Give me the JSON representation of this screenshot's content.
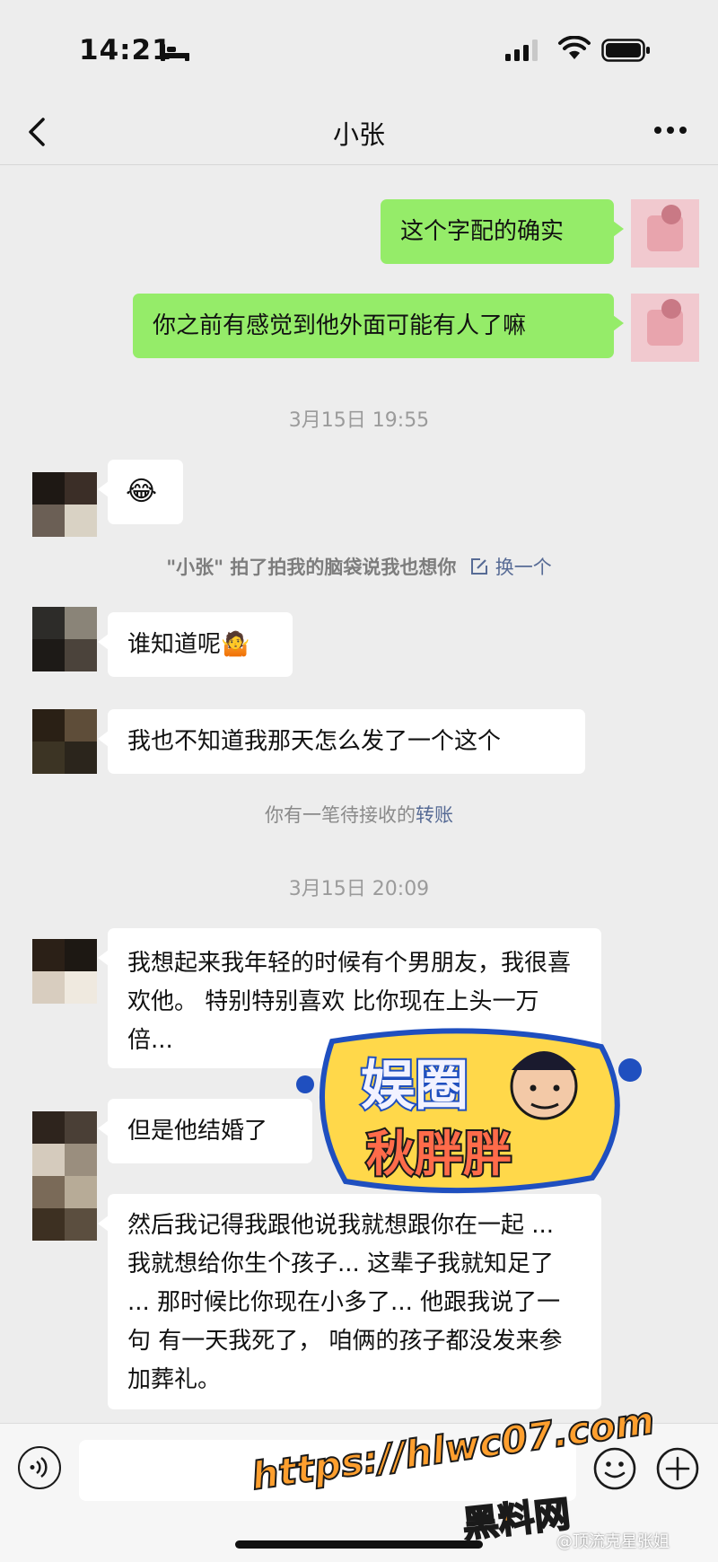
{
  "status_bar": {
    "time": "14:21",
    "icons": [
      "bed-icon",
      "signal-icon",
      "wifi-icon",
      "battery-icon"
    ]
  },
  "nav": {
    "back_icon": "chevron-left-icon",
    "title": "小张",
    "more_icon": "more-icon"
  },
  "messages": [
    {
      "side": "right",
      "text": "这个字配的确实"
    },
    {
      "side": "right",
      "text": "你之前有感觉到他外面可能有人了嘛"
    },
    {
      "type": "timestamp",
      "text": "3月15日 19:55"
    },
    {
      "side": "left",
      "text": "😂"
    },
    {
      "type": "pat",
      "text": "\"小张\" 拍了拍我的脑袋说我也想你",
      "link": "换一个",
      "link_icon": "edit-icon"
    },
    {
      "side": "left",
      "text": "谁知道呢🤷"
    },
    {
      "side": "left",
      "text": "我也不知道我那天怎么发了一个这个"
    },
    {
      "type": "transfer",
      "text": "你有一笔待接收的",
      "link": "转账"
    },
    {
      "type": "timestamp",
      "text": "3月15日 20:09"
    },
    {
      "side": "left",
      "text": "我想起来我年轻的时候有个男朋友，我很喜欢他。 特别特别喜欢 比你现在上头一万倍..."
    },
    {
      "side": "left",
      "text": "但是他结婚了"
    },
    {
      "side": "left",
      "text": "然后我记得我跟他说我就想跟你在一起 ... 我就想给你生个孩子... 这辈子我就知足了 ... 那时候比你现在小多了... 他跟我说了一句 有一天我死了， 咱俩的孩子都没发来参加葬礼。"
    }
  ],
  "input_bar": {
    "voice_icon": "voice-icon",
    "emoji_icon": "emoji-icon",
    "plus_icon": "plus-icon",
    "value": ""
  },
  "watermarks": {
    "sticker_line1": "娱圈",
    "sticker_line2": "秋胖胖",
    "url": "https://hlwc07.com",
    "site": "黑料网",
    "credit": "@顶流克星张姐"
  },
  "colors": {
    "background": "#ededed",
    "bubble_green": "#95ec69",
    "bubble_white": "#ffffff",
    "link": "#576b95",
    "timestamp": "#9b9b9b"
  }
}
